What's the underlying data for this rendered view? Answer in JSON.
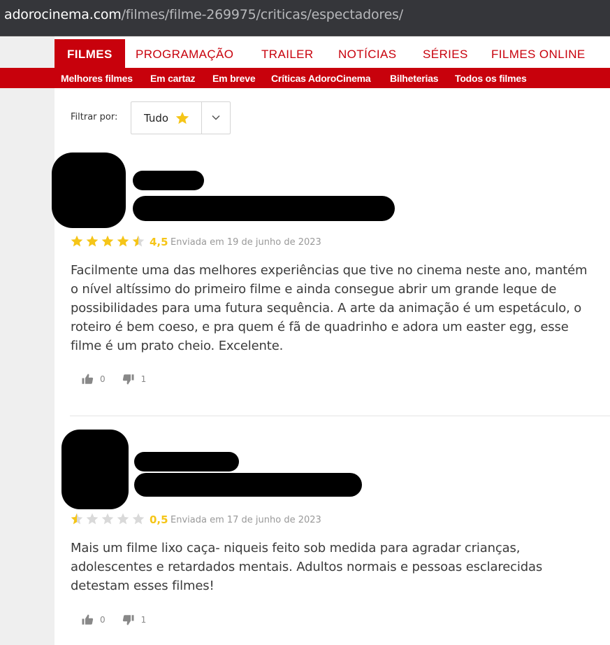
{
  "browser": {
    "url_host": "adorocinema.com",
    "url_path": "/filmes/filme-269975/criticas/espectadores/"
  },
  "nav": {
    "main": [
      "FILMES",
      "PROGRAMAÇÃO",
      "TRAILER",
      "NOTÍCIAS",
      "SÉRIES",
      "FILMES ONLINE"
    ],
    "sub": [
      "Melhores filmes",
      "Em cartaz",
      "Em breve",
      "Críticas AdoroCinema",
      "Bilheterias",
      "Todos os filmes"
    ]
  },
  "filter": {
    "label": "Filtrar por:",
    "value": "Tudo",
    "icon": "star-icon"
  },
  "colors": {
    "brand": "#c8010c",
    "star": "#f5c518",
    "star_empty": "#d9d9d9"
  },
  "reviews": [
    {
      "rating": 4.5,
      "rating_label": "4,5",
      "date": "Enviada em 19 de junho de 2023",
      "text": "Facilmente uma das melhores experiências que tive no cinema neste ano, mantém o nível altíssimo do primeiro filme e ainda consegue abrir um grande leque de possibilidades para uma futura sequência. A arte da animação é um espetáculo, o roteiro é bem coeso, e pra quem é fã de quadrinho e adora um easter egg, esse filme é um prato cheio. Excelente.",
      "likes": "0",
      "dislikes": "1"
    },
    {
      "rating": 0.5,
      "rating_label": "0,5",
      "date": "Enviada em 17 de junho de 2023",
      "text": "Mais um filme lixo caça- niqueis feito sob medida para agradar crianças, adolescentes e retardados mentais. Adultos normais e pessoas esclarecidas detestam esses filmes!",
      "likes": "0",
      "dislikes": "1"
    }
  ]
}
